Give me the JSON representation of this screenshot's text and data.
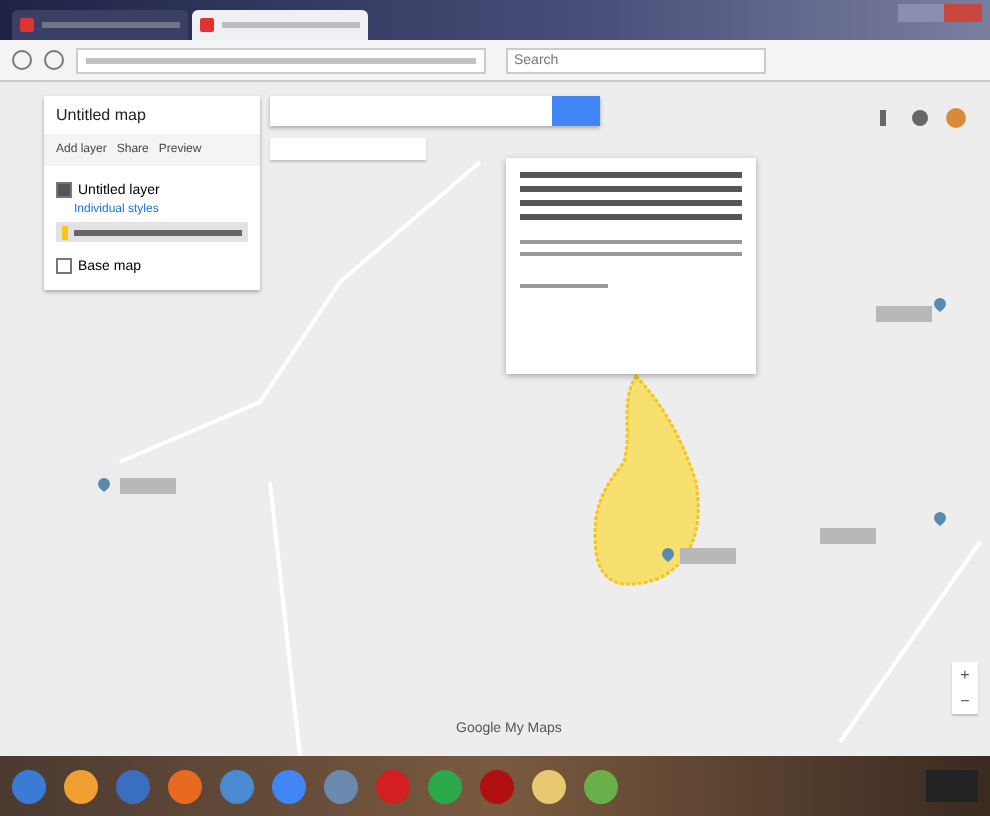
{
  "browser": {
    "tabs": [
      {
        "selected": false
      },
      {
        "selected": true
      }
    ],
    "search_placeholder": "Search"
  },
  "panel": {
    "title": "Untitled map",
    "actions": [
      "Add layer",
      "Share",
      "Preview"
    ],
    "layers": [
      {
        "kind": "layer",
        "name": "Untitled layer",
        "checked": true,
        "style": "Individual styles",
        "features": [
          {
            "selected": true
          }
        ]
      },
      {
        "kind": "basemap",
        "name": "Base map",
        "checked": false
      }
    ]
  },
  "popup": {
    "open": true
  },
  "attribution": "Google My Maps",
  "zoom": [
    "+",
    "−"
  ]
}
